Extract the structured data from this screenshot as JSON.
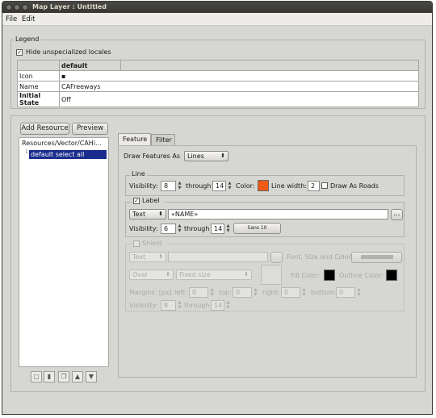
{
  "window": {
    "title": "Map Layer : Untitled"
  },
  "menu": {
    "file": "File",
    "edit": "Edit"
  },
  "legend": {
    "group_label": "Legend",
    "hide_unspecialized": "Hide unspecialized locales",
    "column_header": "default",
    "rows": [
      {
        "label": "Icon",
        "value": "▪"
      },
      {
        "label": "Name",
        "value": "CAFreeways"
      },
      {
        "label": "Initial State",
        "value": "Off"
      }
    ]
  },
  "left": {
    "add_resource": "Add Resource",
    "preview": "Preview",
    "tree_root": "Resources/Vector/CAHi...",
    "tree_child": "default select all"
  },
  "tabs": {
    "feature": "Feature",
    "filter": "Filter"
  },
  "feature": {
    "draw_as_label": "Draw Features As",
    "draw_as_value": "Lines",
    "line": {
      "group": "Line",
      "visibility_label": "Visibility:",
      "vis_from": "8",
      "through": "through",
      "vis_to": "14",
      "color_label": "Color:",
      "color": "#f05a14",
      "width_label": "Line width:",
      "width": "2",
      "draw_roads": "Draw As Roads"
    },
    "label": {
      "group": "Label",
      "type": "Text",
      "text": "«NAME»",
      "ellipsis": "...",
      "visibility_label": "Visibility:",
      "vis_from": "6",
      "through": "through",
      "vis_to": "14",
      "font": "Sans 10"
    },
    "shield": {
      "group": "Shield",
      "type": "Text",
      "font_size_color": "Font, Size and Color:",
      "shape": "Oval",
      "size": "Fixed size",
      "fill_color": "Fill Color:",
      "outline_color": "Outline Color:",
      "margins": "Margins: [px]",
      "left": "left:",
      "left_val": "0",
      "top": "top:",
      "top_val": "0",
      "right": "right:",
      "right_val": "0",
      "bottom": "bottom:",
      "bottom_val": "0",
      "visibility_label": "Visibility:",
      "vis_from": "8",
      "through": "through",
      "vis_to": "14"
    }
  }
}
